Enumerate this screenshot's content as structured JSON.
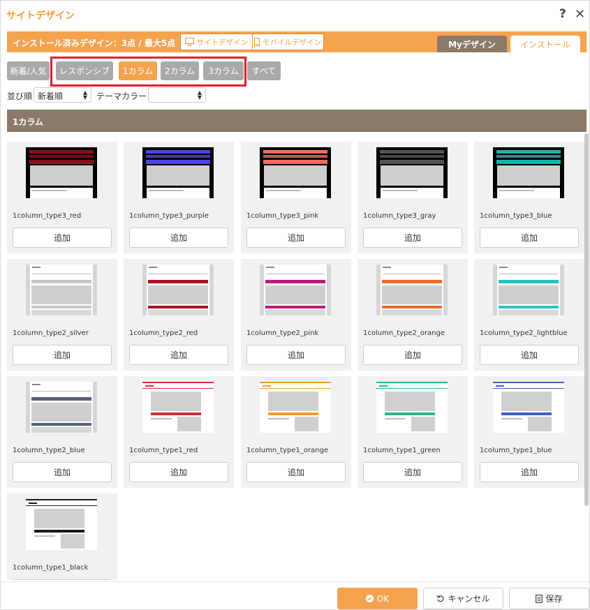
{
  "window": {
    "title": "サイトデザイン",
    "help_icon": "question-mark-icon",
    "close_icon": "close-icon"
  },
  "topbar": {
    "installed_text": "インストール済みデザイン：3点 / 最大5点",
    "device_tabs": [
      "サイトデザイン",
      "モバイルデザイン"
    ],
    "tabs": [
      "Myデザイン",
      "インストール"
    ],
    "active_tab": "インストール"
  },
  "filters": {
    "buttons": [
      "新着/人気",
      "レスポンシブ",
      "1カラム",
      "2カラム",
      "3カラム",
      "すべて"
    ],
    "active": "1カラム"
  },
  "sort": {
    "label": "並び順",
    "value": "新着順",
    "theme_label": "テーマカラー",
    "theme_value": ""
  },
  "section_title": "1カラム",
  "add_label": "追加",
  "designs": [
    {
      "name": "1column_type3_red",
      "type": 3,
      "color": "#8b0f1c"
    },
    {
      "name": "1column_type3_purple",
      "type": 3,
      "color": "#4a46e0"
    },
    {
      "name": "1column_type3_pink",
      "type": 3,
      "color": "#f26a5a"
    },
    {
      "name": "1column_type3_gray",
      "type": 3,
      "color": "#555555"
    },
    {
      "name": "1column_type3_blue",
      "type": 3,
      "color": "#1bb2a8"
    },
    {
      "name": "1column_type2_silver",
      "type": 2,
      "color": "#c8c8c8"
    },
    {
      "name": "1column_type2_red",
      "type": 2,
      "color": "#b01020"
    },
    {
      "name": "1column_type2_pink",
      "type": 2,
      "color": "#c4167a"
    },
    {
      "name": "1column_type2_orange",
      "type": 2,
      "color": "#f26a2a"
    },
    {
      "name": "1column_type2_lightblue",
      "type": 2,
      "color": "#22c4c4"
    },
    {
      "name": "1column_type2_blue",
      "type": 2,
      "color": "#56607a"
    },
    {
      "name": "1column_type1_red",
      "type": 1,
      "color": "#d0303a"
    },
    {
      "name": "1column_type1_orange",
      "type": 1,
      "color": "#f39a2a"
    },
    {
      "name": "1column_type1_green",
      "type": 1,
      "color": "#2ab48e"
    },
    {
      "name": "1column_type1_blue",
      "type": 1,
      "color": "#3a62c0"
    },
    {
      "name": "1column_type1_black",
      "type": 1,
      "color": "#1a1a1a"
    }
  ],
  "footer": {
    "ok": "OK",
    "cancel": "キャンセル",
    "save": "保存"
  },
  "colors": {
    "accent": "#f6a34f",
    "section": "#8b7a69",
    "filter_inactive": "#aaaaaa",
    "highlight": "#e0202a"
  }
}
